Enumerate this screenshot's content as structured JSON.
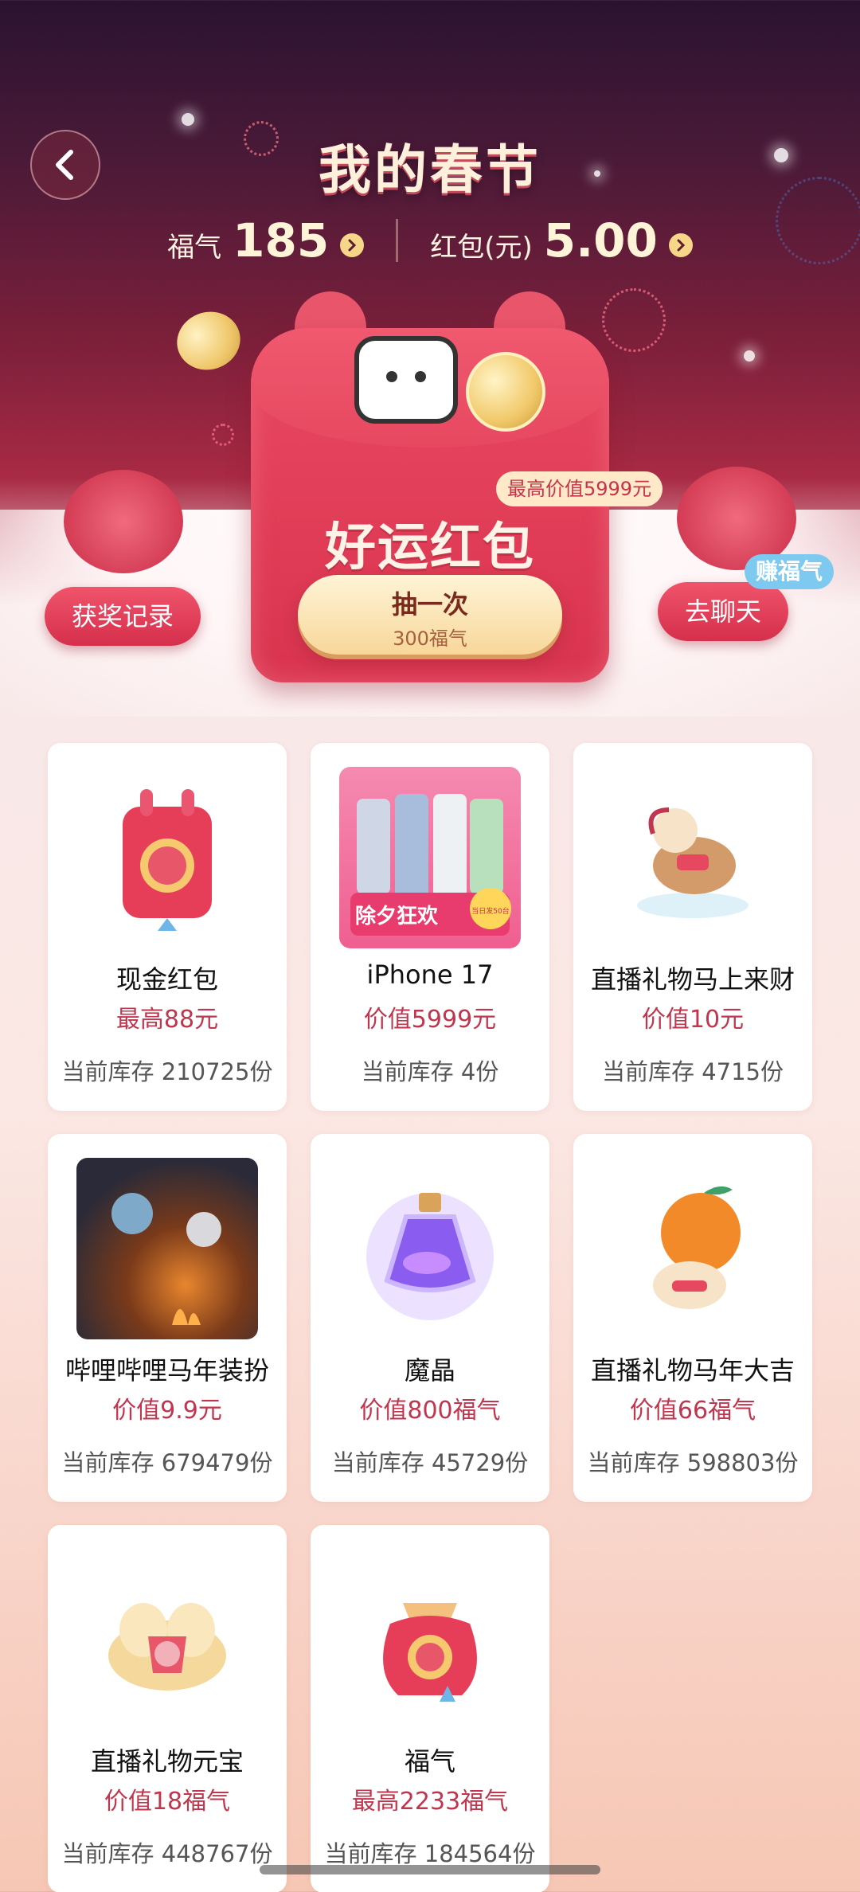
{
  "header": {
    "title": "我的春节",
    "fuqi_label": "福气",
    "fuqi_value": "185",
    "redpacket_label": "红包(元)",
    "redpacket_value": "5.00"
  },
  "envelope": {
    "max_value_tag": "最高价值5999元",
    "title": "好运红包",
    "draw_button_label": "抽一次",
    "draw_button_cost": "300福气"
  },
  "side_actions": {
    "left_label": "获奖记录",
    "right_label": "去聊天",
    "right_tag": "赚福气"
  },
  "prizes": [
    {
      "name": "现金红包",
      "price": "最高88元",
      "stock": "当前库存 210725份",
      "icon": "red-envelope-icon"
    },
    {
      "name": "iPhone 17",
      "price": "价值5999元",
      "stock": "当前库存 4份",
      "icon": "phone-image",
      "promo_title": "除夕狂欢",
      "promo_badge": "当日发50台"
    },
    {
      "name": "直播礼物马上来财",
      "price": "价值10元",
      "stock": "当前库存 4715份",
      "icon": "horse-gift-icon"
    },
    {
      "name": "哔哩哔哩马年装扮",
      "price": "价值9.9元",
      "stock": "当前库存 679479份",
      "icon": "illustration-image"
    },
    {
      "name": "魔晶",
      "price": "价值800福气",
      "stock": "当前库存 45729份",
      "icon": "potion-bottle-icon"
    },
    {
      "name": "直播礼物马年大吉",
      "price": "价值66福气",
      "stock": "当前库存 598803份",
      "icon": "orange-horse-icon"
    },
    {
      "name": "直播礼物元宝",
      "price": "价值18福气",
      "stock": "当前库存 448767份",
      "icon": "ingot-icon"
    },
    {
      "name": "福气",
      "price": "最高2233福气",
      "stock": "当前库存 184564份",
      "icon": "lucky-bag-icon"
    }
  ],
  "colors": {
    "accent_red": "#c0364e",
    "envelope_red": "#e03c57",
    "gold": "#f6d78a"
  }
}
